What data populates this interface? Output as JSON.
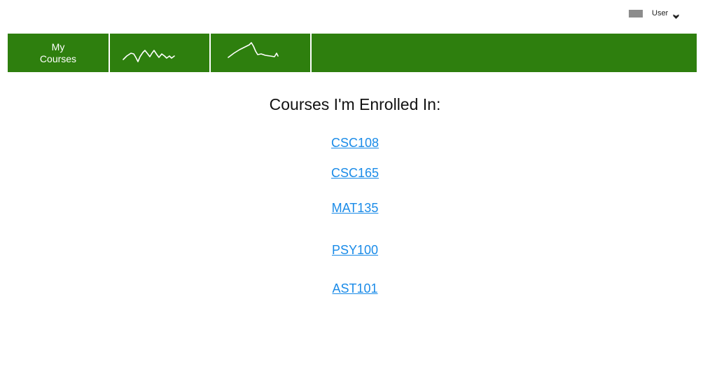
{
  "user_menu": {
    "label": "User",
    "icons": {
      "avatar": "user-avatar-placeholder",
      "chevron": "chevron-down-icon"
    }
  },
  "nav": {
    "courses_label_line1": "My",
    "courses_label_line2": "Courses",
    "sparkline_icons": [
      "sparkline-chart-icon",
      "sparkline-chart-icon"
    ],
    "background_color": "#2e7f0e",
    "text_color": "#ffffff"
  },
  "main": {
    "title": "Courses I'm Enrolled In:",
    "courses": [
      "CSC108",
      "CSC165",
      "MAT135",
      "PSY100",
      "AST101"
    ],
    "link_color": "#1a8be8"
  }
}
